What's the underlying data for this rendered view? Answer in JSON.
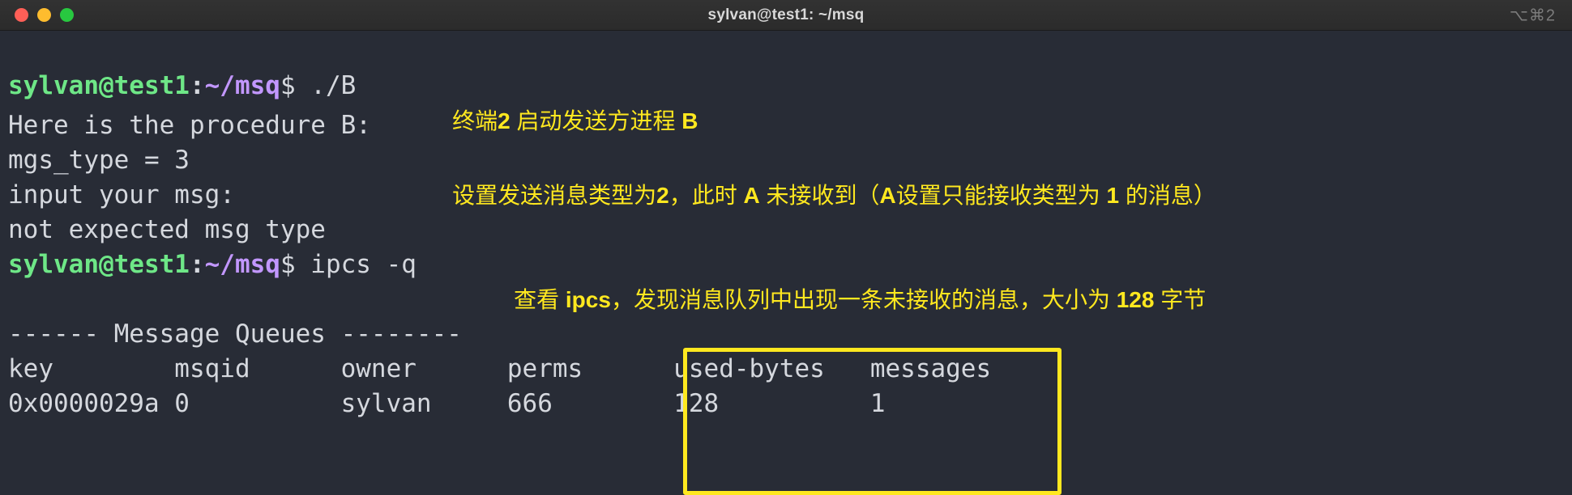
{
  "window": {
    "title": "sylvan@test1: ~/msq",
    "shortcut": "⌥⌘2",
    "controls": {
      "close": "",
      "minimize": "",
      "maximize": ""
    }
  },
  "theme": {
    "background": "#282c36",
    "titlebar": "#2d2d2d",
    "foreground": "#d5d8de",
    "prompt_user": "#6ee787",
    "prompt_path": "#c297ff",
    "annotation": "#ffe81f",
    "highlight_border": "#ffe81f"
  },
  "terminal": {
    "prompt": {
      "user_host": "sylvan@test1",
      "separator": ":",
      "path": "~/msq",
      "sigil": "$"
    },
    "lines": [
      {
        "type": "prompt",
        "command": " ./B"
      },
      {
        "type": "output",
        "text": "Here is the procedure B:"
      },
      {
        "type": "output",
        "text": "mgs_type = 3"
      },
      {
        "type": "output",
        "text": "input your msg:"
      },
      {
        "type": "output",
        "text": "not expected msg type"
      },
      {
        "type": "prompt",
        "command": " ipcs -q"
      },
      {
        "type": "output",
        "text": ""
      },
      {
        "type": "output",
        "text": "------ Message Queues --------"
      },
      {
        "type": "output",
        "text": "key        msqid      owner      perms      used-bytes   messages"
      },
      {
        "type": "output",
        "text": "0x0000029a 0          sylvan     666        128          1"
      }
    ],
    "table": {
      "section_header": "------ Message Queues --------",
      "columns": [
        "key",
        "msqid",
        "owner",
        "perms",
        "used-bytes",
        "messages"
      ],
      "rows": [
        [
          "0x0000029a",
          "0",
          "sylvan",
          "666",
          "128",
          "1"
        ]
      ]
    }
  },
  "annotations": [
    {
      "id": "note-start-sender",
      "parts": [
        {
          "text": "终端",
          "bold": false
        },
        {
          "text": "2",
          "bold": true
        },
        {
          "text": " 启动发送方进程 ",
          "bold": false
        },
        {
          "text": "B",
          "bold": true
        }
      ],
      "plain": "终端2 启动发送方进程 B"
    },
    {
      "id": "note-msg-type",
      "parts": [
        {
          "text": "设置发送消息类型为",
          "bold": false
        },
        {
          "text": "2",
          "bold": true
        },
        {
          "text": "，此时 ",
          "bold": false
        },
        {
          "text": "A",
          "bold": true
        },
        {
          "text": " 未接收到（",
          "bold": false
        },
        {
          "text": "A",
          "bold": true
        },
        {
          "text": "设置只能接收类型为 ",
          "bold": false
        },
        {
          "text": "1",
          "bold": true
        },
        {
          "text": " 的消息）",
          "bold": false
        }
      ],
      "plain": "设置发送消息类型为2，此时 A 未接收到（A设置只能接收类型为 1 的消息）"
    },
    {
      "id": "note-ipcs",
      "parts": [
        {
          "text": "查看 ",
          "bold": false
        },
        {
          "text": "ipcs",
          "bold": true
        },
        {
          "text": "，发现消息队列中出现一条未接收的消息，大小为 ",
          "bold": false
        },
        {
          "text": "128",
          "bold": true
        },
        {
          "text": " 字节",
          "bold": false
        }
      ],
      "plain": "查看 ipcs，发现消息队列中出现一条未接收的消息，大小为 128 字节"
    }
  ],
  "highlight": {
    "label": "used-bytes-and-messages-highlight",
    "covers": [
      "used-bytes",
      "messages",
      "128",
      "1"
    ]
  }
}
